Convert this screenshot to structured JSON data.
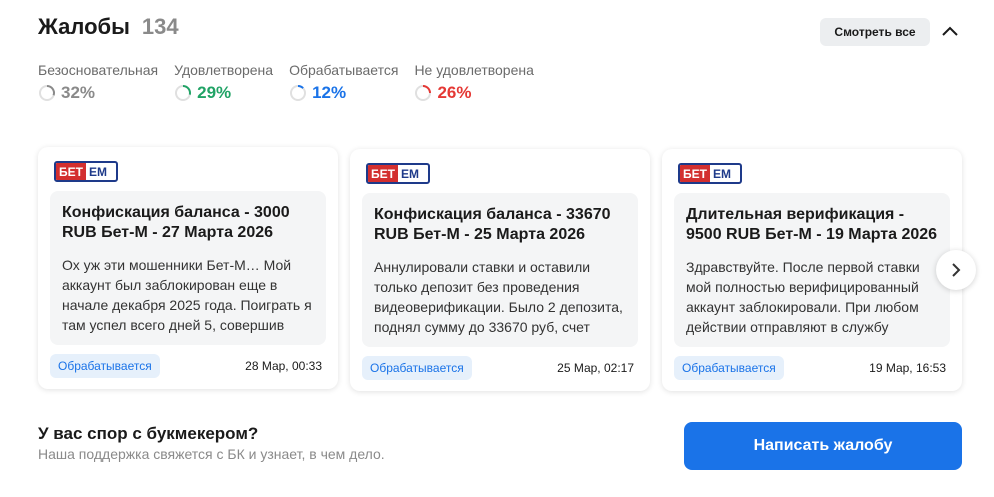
{
  "header": {
    "title": "Жалобы",
    "count": "134"
  },
  "see_all_label": "Смотреть все",
  "stats": [
    {
      "label": "Безосновательная",
      "value": "32%",
      "color": "#8a8a8a"
    },
    {
      "label": "Удовлетворена",
      "value": "29%",
      "color": "#21a366"
    },
    {
      "label": "Обрабатывается",
      "value": "12%",
      "color": "#1a73e8"
    },
    {
      "label": "Не удовлетворена",
      "value": "26%",
      "color": "#e53935"
    }
  ],
  "logo": {
    "part1": "БЕТ",
    "part2": "EM"
  },
  "cards": [
    {
      "title": "Конфискация баланса - 3000 RUB Бет-М - 27 Марта 2026",
      "body": "Ох уж эти мошенники Бет-М… Мой аккаунт был заблокирован еще в начале декабря 2025 года. Поиграть я там успел всего дней 5, совершив",
      "status": "Обрабатывается",
      "date": "28 Мар, 00:33"
    },
    {
      "title": "Конфискация баланса - 33670 RUB Бет-М - 25 Марта 2026",
      "body": "Аннулировали ставки и оставили только депозит без проведения видеоверификации. Было 2 депозита, поднял сумму до 33670 руб, счет",
      "status": "Обрабатывается",
      "date": "25 Мар, 02:17"
    },
    {
      "title": "Длительная верификация - 9500 RUB Бет-М - 19 Марта 2026",
      "body": "Здравствуйте. После первой ставки мой полностью верифицированный аккаунт заблокировали. При любом действии отправляют в службу",
      "status": "Обрабатывается",
      "date": "19 Мар, 16:53"
    }
  ],
  "footer": {
    "title": "У вас спор с букмекером?",
    "subtitle": "Наша поддержка свяжется с БК и узнает, в чем дело.",
    "button": "Написать жалобу"
  },
  "colors": {
    "accent": "#1a73e8",
    "badge_bg": "#e6f0fb"
  }
}
